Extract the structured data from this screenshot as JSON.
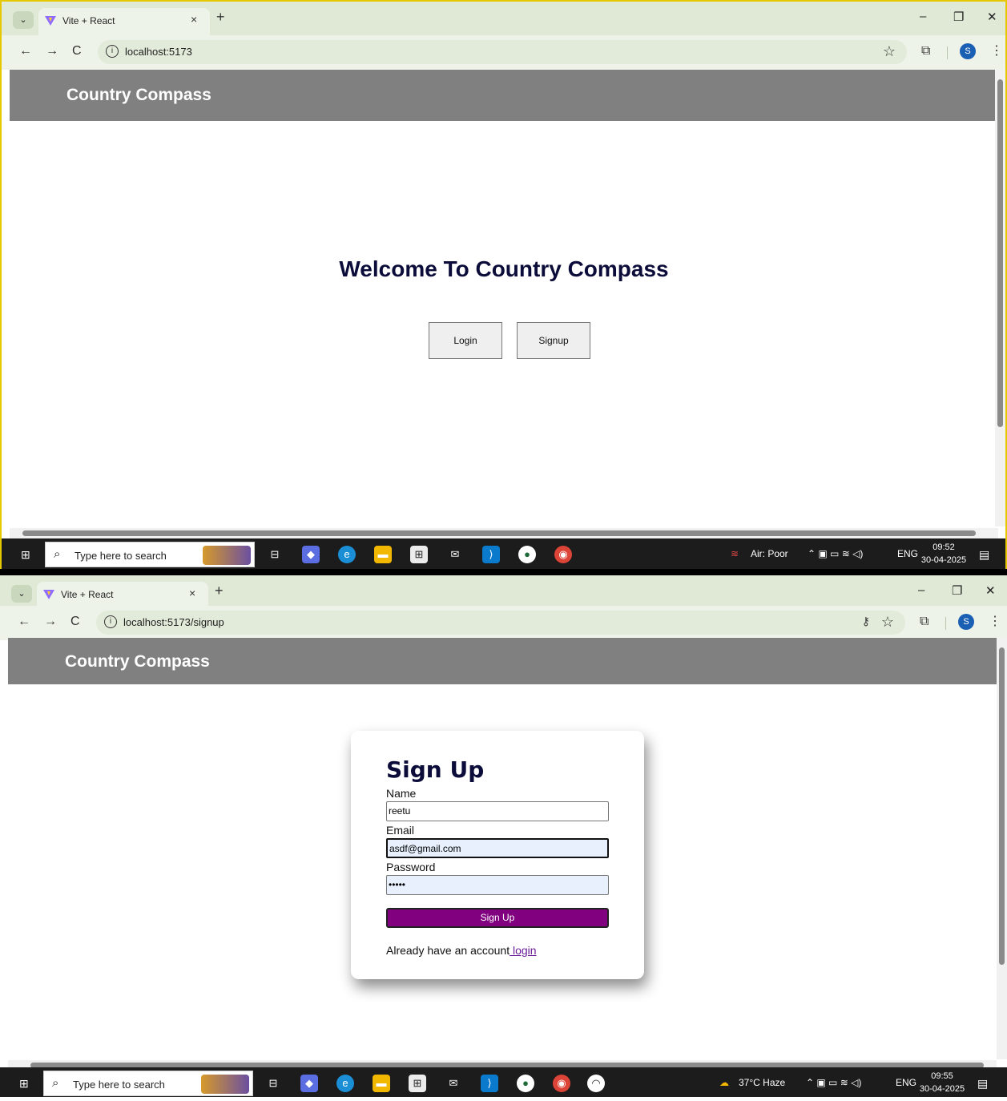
{
  "browser": {
    "tab_title": "Vite + React",
    "tab_close": "×",
    "new_tab": "+",
    "minimize": "–",
    "restore": "❐",
    "close": "✕",
    "back": "←",
    "forward": "→",
    "reload": "C",
    "profile_initial": "S",
    "menu": "⋮"
  },
  "screen1": {
    "url": "localhost:5173",
    "brand": "Country Compass",
    "welcome": "Welcome To Country Compass",
    "login_label": "Login",
    "signup_label": "Signup",
    "taskbar": {
      "search_placeholder": "Type here to search",
      "weather": "Air: Poor",
      "lang": "ENG",
      "time": "09:52",
      "date": "30-04-2025"
    }
  },
  "screen2": {
    "url": "localhost:5173/signup",
    "brand": "Country Compass",
    "form": {
      "title": "Sign Up",
      "name_label": "Name",
      "name_value": "reetu",
      "email_label": "Email",
      "email_value": "asdf@gmail.com",
      "password_label": "Password",
      "password_value": "•••••",
      "submit_label": "Sign Up",
      "already_text": "Already have an account",
      "login_link": " login"
    },
    "taskbar": {
      "search_placeholder": "Type here to search",
      "weather": "37°C  Haze",
      "lang": "ENG",
      "time": "09:55",
      "date": "30-04-2025"
    }
  },
  "colors": {
    "header_bg": "#808080",
    "submit_bg": "#800080",
    "title_color": "#0c0c3a"
  }
}
